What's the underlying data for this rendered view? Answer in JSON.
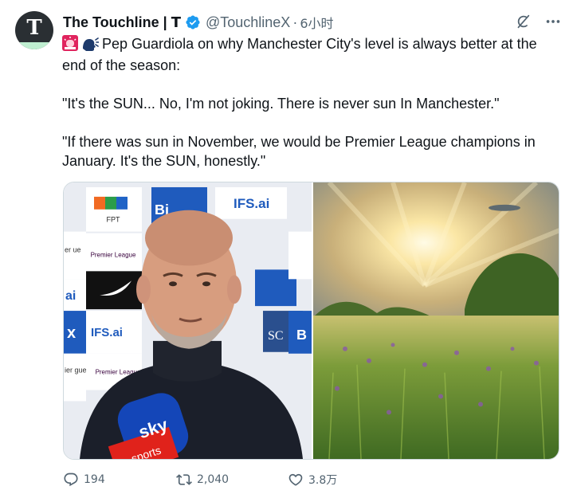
{
  "author": {
    "display_name": "The Touchline | 𝗧",
    "handle": "@TouchlineX",
    "separator": "·",
    "time": "6小时",
    "avatar_letter": "T"
  },
  "tweet": {
    "paragraphs": [
      {
        "id": "intro_1",
        "text": "Pep Guardiola on why Manchester City's level is always better at the"
      },
      {
        "id": "intro_2",
        "text": "end of the season:"
      },
      {
        "id": "quote_1",
        "text": "\"It's the SUN... No, I'm not joking. There is never sun In Manchester.\""
      },
      {
        "id": "quote_2a",
        "text": "\"If there was sun in November, we would be Premier League champions in"
      },
      {
        "id": "quote_2b",
        "text": "January. It's the SUN, honestly.\""
      }
    ],
    "emojis": [
      "siren-icon",
      "speaking-head-icon"
    ]
  },
  "media": {
    "left_image": {
      "description": "interview-photo",
      "board_texts": [
        "FPT",
        "Bi",
        "IFS.ai",
        "Premier League",
        "IFS.ai",
        "Premier League",
        "SC",
        "ai",
        "x",
        "B",
        "er ue",
        "ier gue"
      ],
      "mic_texts": [
        "sky",
        "sports"
      ]
    },
    "right_image": {
      "description": "sunlit-meadow"
    }
  },
  "actions": {
    "reply_count": "194",
    "retweet_count": "2,040",
    "like_count": "3.8万"
  },
  "colors": {
    "text": "#0f1419",
    "muted": "#536471",
    "verified": "#1d9bf0",
    "border": "#cfd9de"
  }
}
